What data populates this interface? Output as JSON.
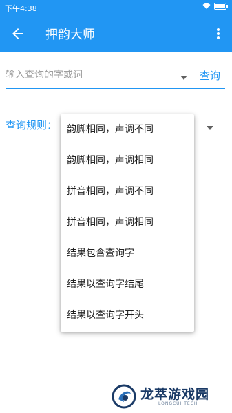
{
  "status_bar": {
    "time": "下午4:38"
  },
  "app_bar": {
    "title": "押韵大师"
  },
  "search": {
    "placeholder": "输入查询的字或词",
    "button_label": "查询"
  },
  "rule": {
    "label": "查询规则："
  },
  "menu": {
    "items": [
      "韵脚相同，声调不同",
      "韵脚相同，声调相同",
      "拼音相同，声调不同",
      "拼音相同，声调相同",
      "结果包含查询字",
      "结果以查询字结尾",
      "结果以查询字开头"
    ]
  },
  "watermark": {
    "name": "龙萃游戏园",
    "sub": "LONGCUI TECH"
  },
  "colors": {
    "primary": "#2196f3",
    "text": "#212121",
    "hint": "#9e9e9e"
  }
}
